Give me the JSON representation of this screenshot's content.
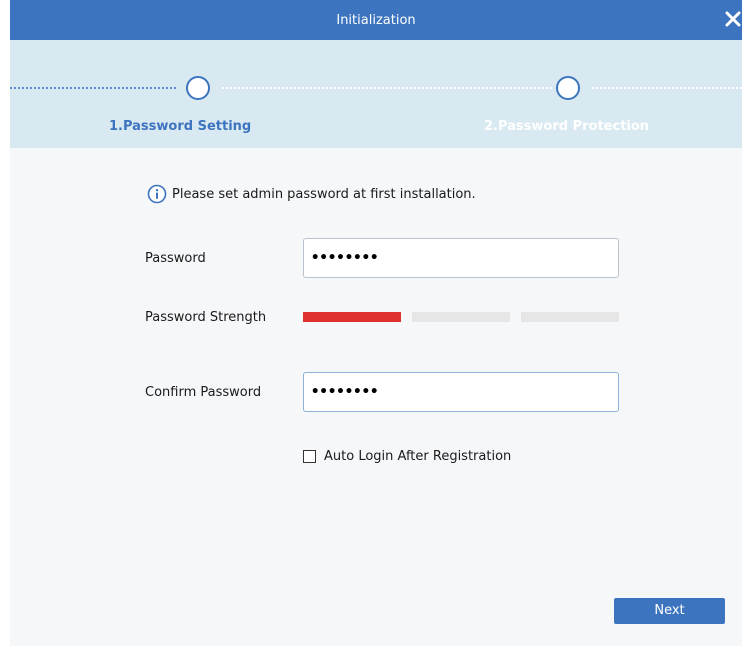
{
  "window": {
    "title": "Initialization"
  },
  "stepper": {
    "steps": [
      {
        "label": "1.Password Setting",
        "state": "active"
      },
      {
        "label": "2.Password Protection",
        "state": "inactive"
      }
    ]
  },
  "info": {
    "message": "Please set admin password at first installation."
  },
  "form": {
    "password_label": "Password",
    "password_value": "••••••••",
    "strength_label": "Password Strength",
    "strength_level": 1,
    "strength_levels_total": 3,
    "confirm_label": "Confirm Password",
    "confirm_value": "••••••••",
    "auto_login_label": "Auto Login After Registration",
    "auto_login_checked": false
  },
  "actions": {
    "next_label": "Next"
  },
  "colors": {
    "brand": "#3d74bf",
    "stepper_bg": "#d9e9f2",
    "strength_weak": "#e03131",
    "strength_empty": "#e6e6e6"
  }
}
